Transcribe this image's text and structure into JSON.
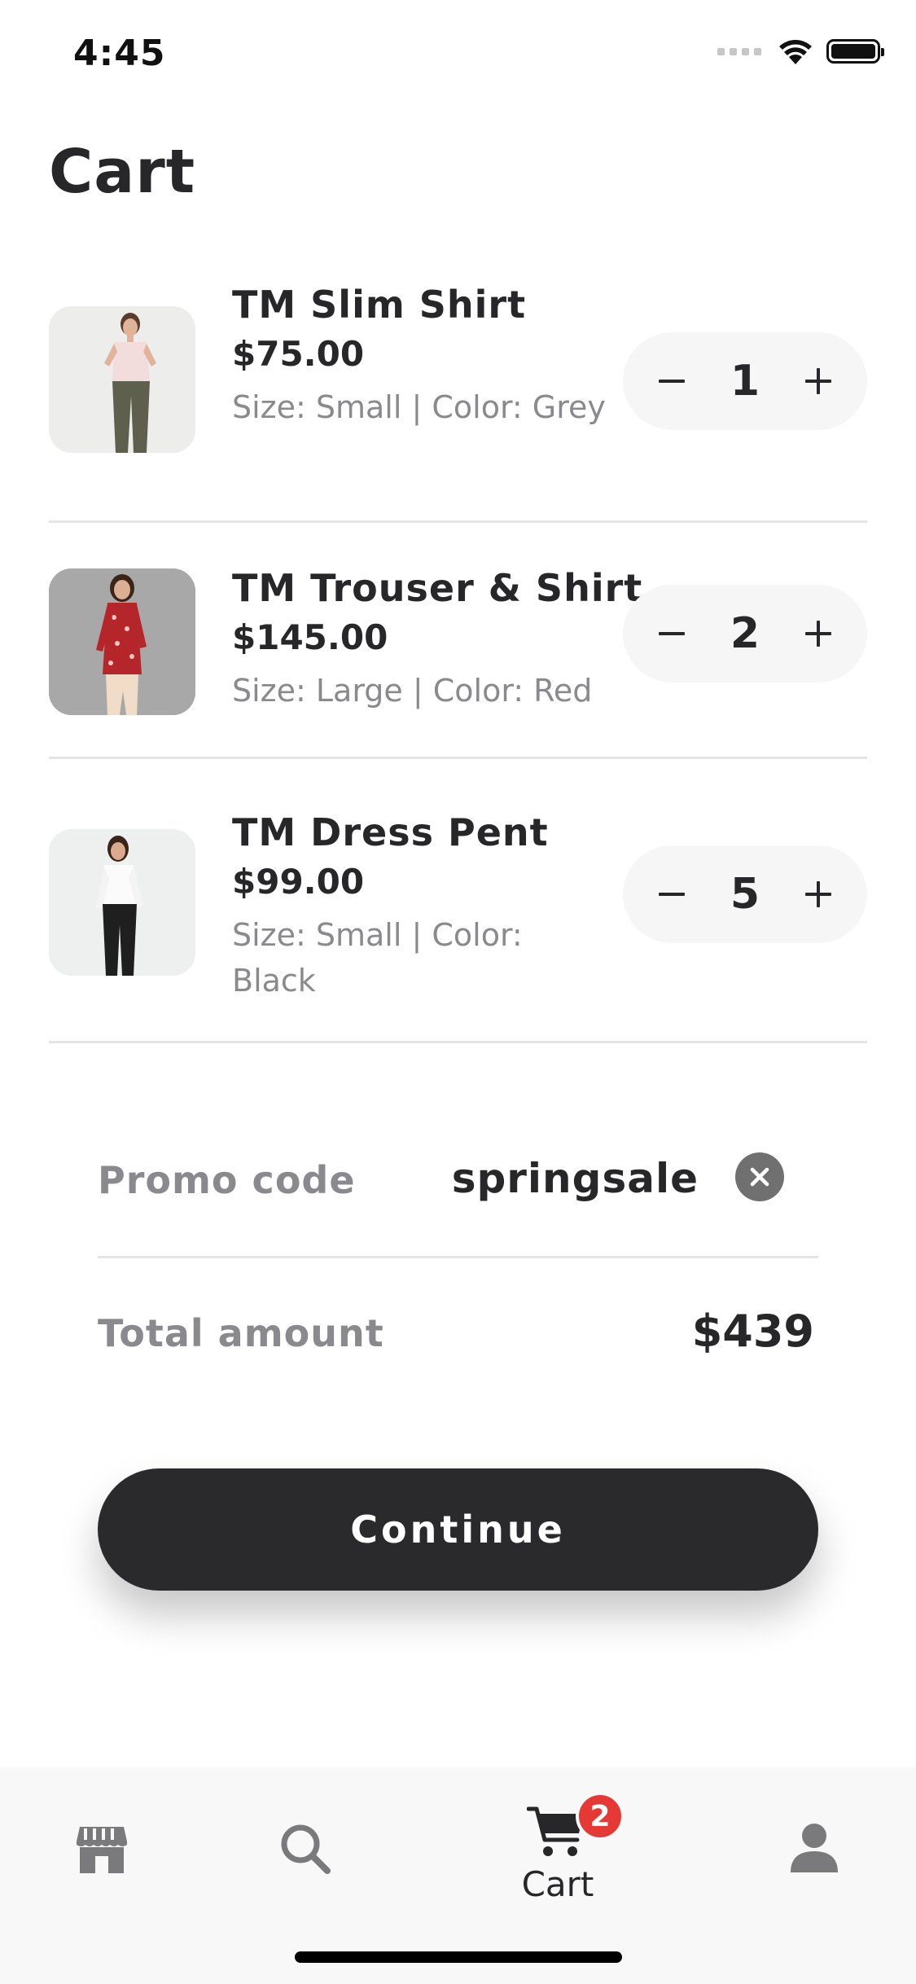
{
  "status_bar": {
    "time": "4:45"
  },
  "page": {
    "title": "Cart"
  },
  "cart": {
    "items": [
      {
        "name": "TM Slim Shirt",
        "price": "$75.00",
        "variant": "Size:  Small  |  Color:  Grey",
        "quantity": "1",
        "image_icon": "pink-shirt-photo"
      },
      {
        "name": "TM Trouser & Shirt",
        "price": "$145.00",
        "variant": "Size:  Large  |  Color:  Red",
        "quantity": "2",
        "image_icon": "red-shirt-photo"
      },
      {
        "name": "TM Dress Pent",
        "price": "$99.00",
        "variant": "Size:  Small  |  Color:  Black",
        "quantity": "5",
        "image_icon": "black-pants-photo"
      }
    ]
  },
  "summary": {
    "promo_label": "Promo code",
    "promo_value": "springsale",
    "total_label": "Total amount",
    "total_value": "$439"
  },
  "actions": {
    "continue_label": "Continue"
  },
  "tab_bar": {
    "tabs": [
      {
        "icon": "store-icon",
        "label": ""
      },
      {
        "icon": "search-icon",
        "label": ""
      },
      {
        "icon": "cart-icon",
        "label": "Cart",
        "badge": "2"
      },
      {
        "icon": "user-icon",
        "label": ""
      }
    ]
  },
  "colors": {
    "text_primary": "#27272a",
    "text_secondary": "#8a8a8e",
    "button_dark": "#2a2a2c",
    "badge_red": "#e53935",
    "stepper_bg": "#f6f6f7",
    "divider": "#e4e4e6"
  }
}
